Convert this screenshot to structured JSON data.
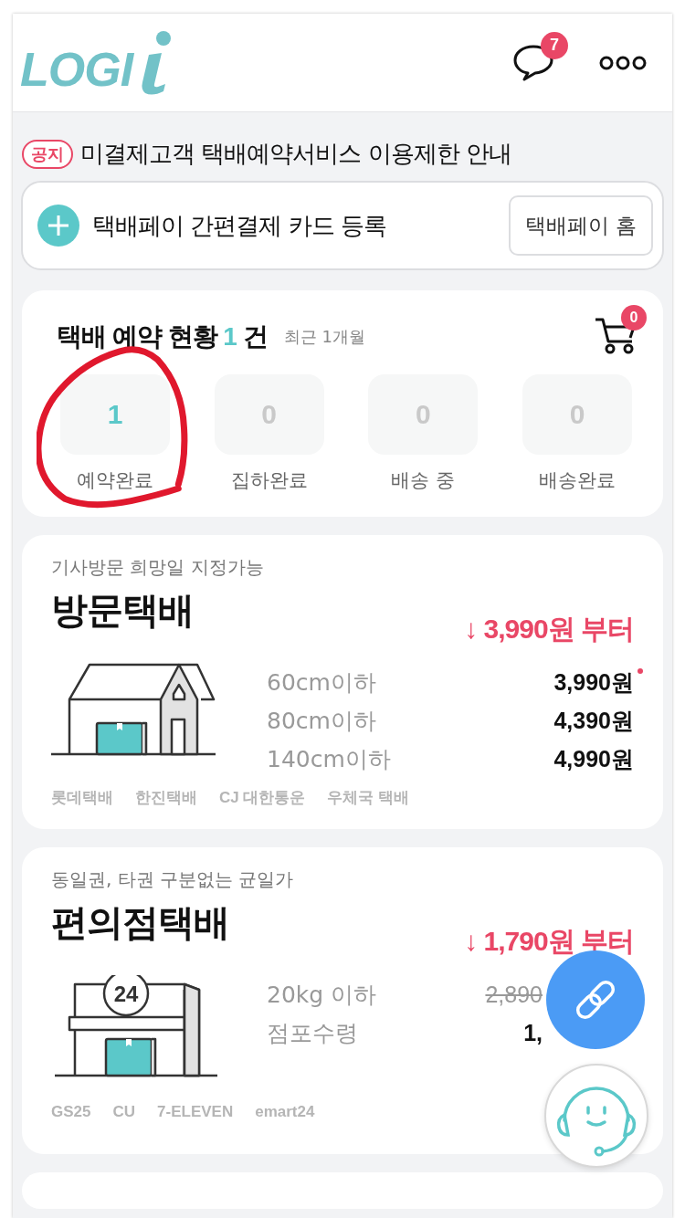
{
  "header": {
    "logo": "LOGI",
    "chat_badge": "7"
  },
  "notice": {
    "tag": "공지",
    "text": "미결제고객 택배예약서비스 이용제한 안내"
  },
  "pay": {
    "text": "택배페이 간편결제 카드 등록",
    "button": "택배페이 홈"
  },
  "status": {
    "title": "택배 예약 현황",
    "count": "1",
    "unit": "건",
    "period": "최근 1개월",
    "cart_badge": "0",
    "steps": [
      {
        "value": "1",
        "label": "예약완료",
        "active": true
      },
      {
        "value": "0",
        "label": "집하완료",
        "active": false
      },
      {
        "value": "0",
        "label": "배송 중",
        "active": false
      },
      {
        "value": "0",
        "label": "배송완료",
        "active": false
      }
    ]
  },
  "annotations": [
    {
      "kind": "circle"
    }
  ],
  "services": [
    {
      "kind": "house",
      "subtitle": "기사방문 희망일 지정가능",
      "title": "방문택배",
      "from_price": "↓ 3,990원 부터",
      "rows": [
        {
          "label": "60cm이하",
          "price": "3,990원",
          "dot": true,
          "strike": false
        },
        {
          "label": "80cm이하",
          "price": "4,390원",
          "dot": false,
          "strike": false
        },
        {
          "label": "140cm이하",
          "price": "4,990원",
          "dot": false,
          "strike": false
        }
      ],
      "carriers": [
        "롯데택배",
        "한진택배",
        "CJ 대한통운",
        "우체국 택배"
      ]
    },
    {
      "kind": "store",
      "sign": "24",
      "subtitle": "동일권, 타권 구분없는 균일가",
      "title": "편의점택배",
      "from_price": "↓ 1,790원 부터",
      "rows": [
        {
          "label": "20kg 이하",
          "price": "2,890",
          "dot": false,
          "strike": true
        },
        {
          "label": "점포수령",
          "price": "1,",
          "dot": false,
          "strike": false
        }
      ],
      "carriers": [
        "GS25",
        "CU",
        "7-ELEVEN",
        "emart24"
      ]
    }
  ]
}
